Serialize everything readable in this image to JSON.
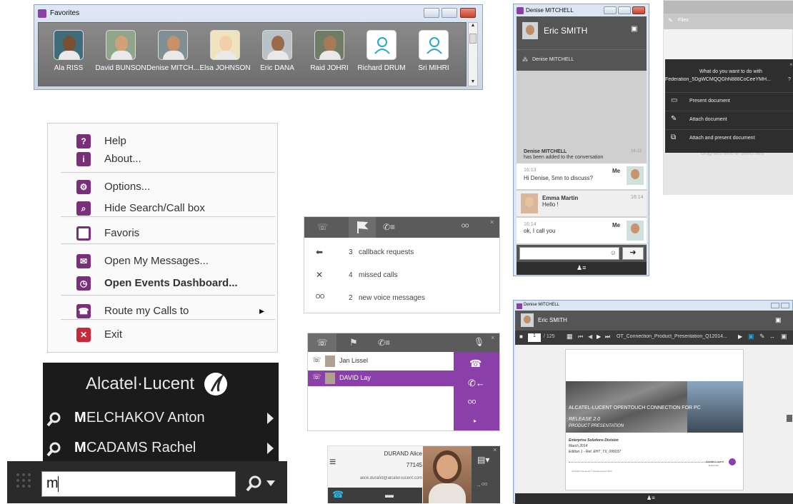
{
  "favorites": {
    "title": "Favorites",
    "contacts": [
      {
        "name": "Ala RISS",
        "skin": "#7a4f33",
        "bg": "#3f6b7a"
      },
      {
        "name": "David BUNSON",
        "skin": "#d2a17a",
        "bg": "#8fa68a"
      },
      {
        "name": "Denise MITCH...",
        "skin": "#c9906a",
        "bg": "#7f8f93"
      },
      {
        "name": "Elsa JOHNSON",
        "skin": "#f0cfaa",
        "bg": "#efe3c0"
      },
      {
        "name": "Eric DANA",
        "skin": "#9a6a4a",
        "bg": "#b9c2c6"
      },
      {
        "name": "Raid JOHRI",
        "skin": "#a57a56",
        "bg": "#6f7d66"
      },
      {
        "name": "Richard DRUM",
        "skin": "",
        "bg": ""
      },
      {
        "name": "Sri MIHRI",
        "skin": "",
        "bg": ""
      }
    ]
  },
  "context_menu": {
    "items": [
      {
        "label": "Help",
        "color": "#7a2f7a",
        "glyph": "?"
      },
      {
        "label": "About...",
        "color": "#7a2f7a",
        "glyph": "i"
      },
      {
        "label": "Options...",
        "color": "#7a2f7a",
        "glyph": "⚙"
      },
      {
        "label": "Hide Search/Call box",
        "color": "#7a2f7a",
        "glyph": "⌕"
      },
      {
        "label": "Favoris",
        "color": "#7a2f7a",
        "glyph": ""
      },
      {
        "label": "Open My Messages...",
        "color": "#7a2f7a",
        "glyph": "✉"
      },
      {
        "label": "Open Events Dashboard...",
        "color": "#7a2f7a",
        "glyph": "◷"
      },
      {
        "label": "Route my Calls to",
        "color": "#7a2f7a",
        "glyph": "☎"
      },
      {
        "label": "Exit",
        "color": "#c8283c",
        "glyph": "✕"
      }
    ],
    "route_arrow": "▸"
  },
  "search_box": {
    "brand": "Alcatel·Lucent",
    "results": [
      {
        "bold": "M",
        "rest": "ELCHAKOV Anton"
      },
      {
        "bold": "M",
        "rest": "CADAMS Rachel"
      }
    ],
    "query": "m",
    "colors": {
      "bg": "#1b1b1b",
      "input_bg": "#ffffff"
    }
  },
  "events": {
    "items": [
      {
        "count": "3",
        "text": "callback requests"
      },
      {
        "count": "4",
        "text": "missed calls"
      },
      {
        "count": "2",
        "text": "new voice messages"
      }
    ]
  },
  "calls_panel": {
    "calls": [
      {
        "name": "Jan Lissel",
        "active": false
      },
      {
        "name": "DAVID Lay",
        "active": true
      }
    ],
    "accent": "#8b3fa8"
  },
  "contact_card": {
    "name": "DURAND Alice",
    "phone": "77145",
    "email": "alice.durand@alcatel-lucent.com"
  },
  "chat_window": {
    "title": "Denise MITCHELL",
    "contact": "Eric SMITH",
    "participant": "Denise MITCHELL",
    "system": {
      "name": "Denise MITCHELL",
      "text": "has been added to the conversation",
      "time": "16:13"
    },
    "messages": [
      {
        "time": "16:13",
        "text": "Hi Denise, 5mn to discuss?",
        "sender": "Me"
      },
      {
        "time": "16:14",
        "text": "Hello !",
        "sender": "Emma Martin"
      },
      {
        "time": "16:14",
        "text": "ok, I call you",
        "sender": "Me"
      }
    ]
  },
  "files_dialog": {
    "header": "Files",
    "question": "What do you want to do with",
    "filename": "Federation_5DgWCMQQGhN888CoCeeYMH...",
    "help": "?",
    "close": "×",
    "options": [
      "Present document",
      "Attach document",
      "Attach and present document"
    ],
    "drop_hint": "Drag files here or select files"
  },
  "presentation": {
    "title": "Denise MITCHELL",
    "contact": "Eric SMITH",
    "page": "1",
    "total": "/ 125",
    "doc_name": "OT_Connection_Product_Presentation_Q12014...",
    "slide": {
      "headline": "ALCATEL-LUCENT OPENTOUCH CONNECTION FOR PC",
      "release": "RELEASE 2.0",
      "subtitle": "PRODUCT PRESENTATION",
      "division": "Enterprise Solutions Division",
      "date": "March 2014",
      "edition": "Edition 1 - Ref. EHT_TX_006037",
      "footer_brand": "Alcatel-Lucent",
      "footer_sub": "Enterprise",
      "legal": "All Rights Reserved © Alcatel-Lucent 2014"
    }
  }
}
